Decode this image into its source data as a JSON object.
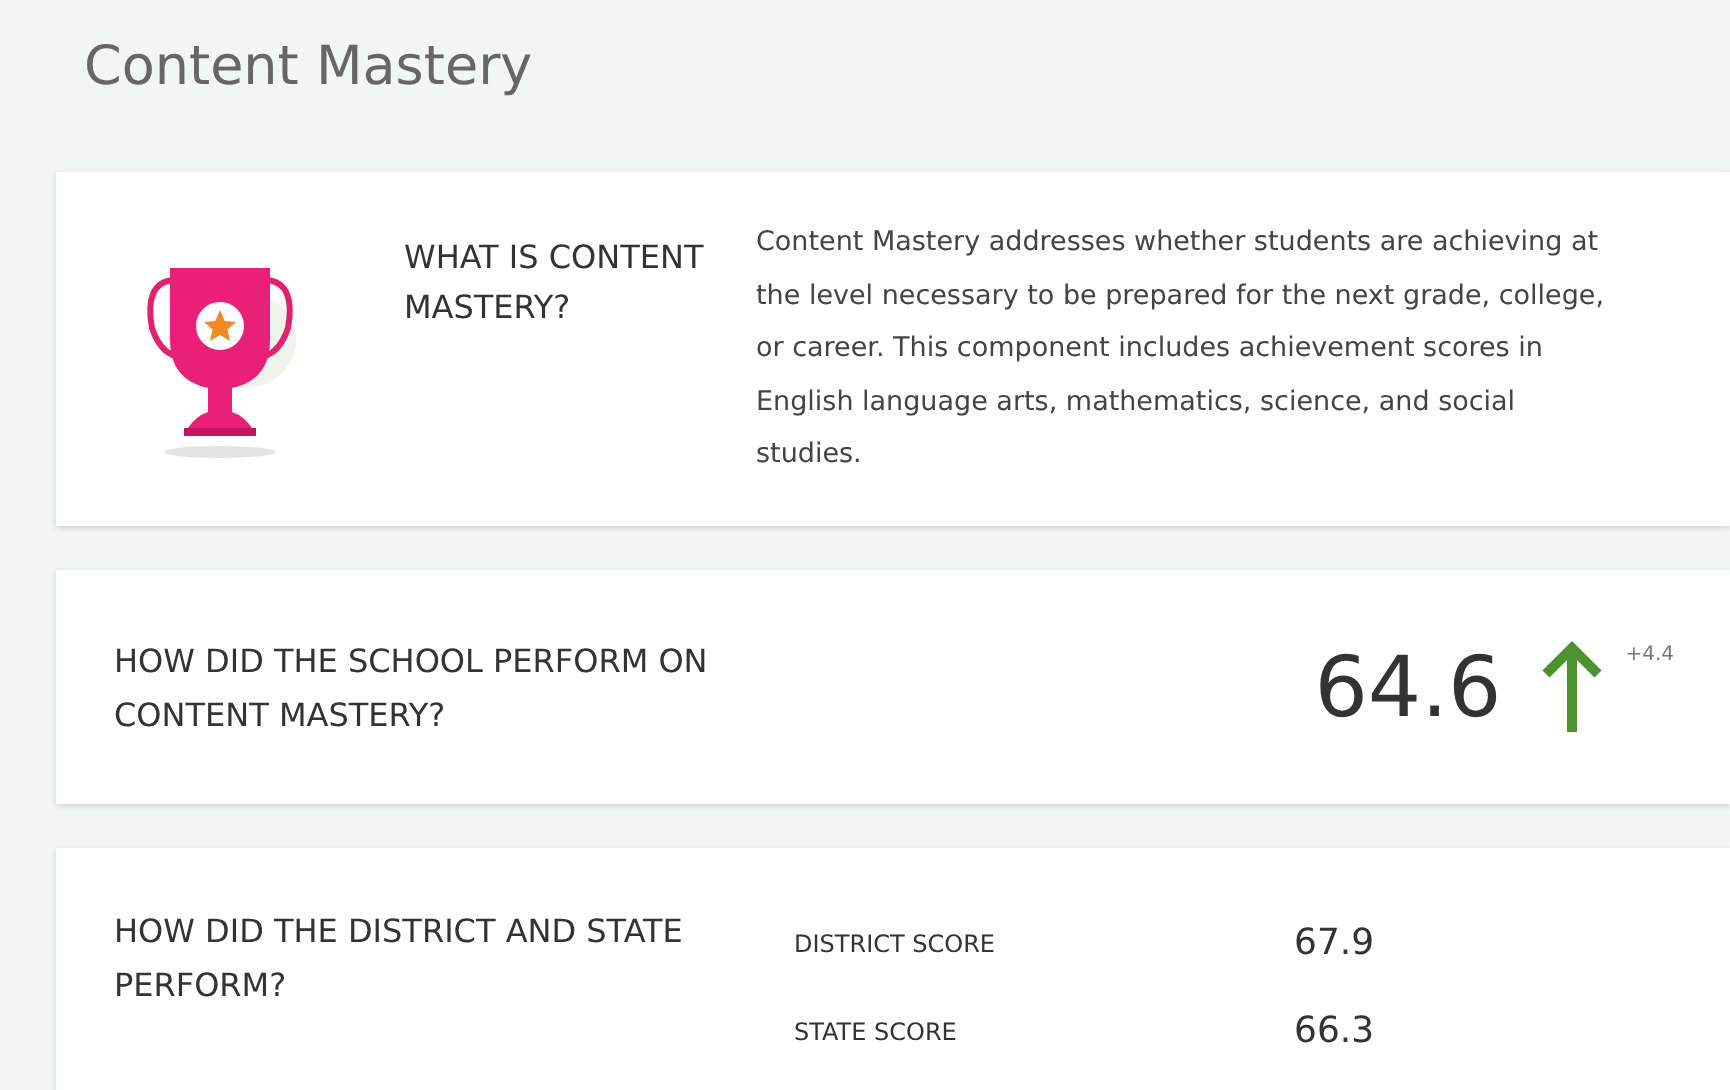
{
  "page_title": "Content Mastery",
  "about": {
    "heading": "WHAT IS CONTENT MASTERY?",
    "text": "Content Mastery addresses whether students are achieving at the level necessary to be prepared for the next grade, college, or career. This component includes achievement scores in English language arts, mathematics, science, and social studies."
  },
  "school": {
    "heading": "HOW DID THE SCHOOL PERFORM ON CONTENT MASTERY?",
    "score": "64.6",
    "rising": true,
    "change": "+4.4"
  },
  "comparison": {
    "heading": "HOW DID THE DISTRICT AND STATE PERFORM?",
    "rows": [
      {
        "label": "DISTRICT SCORE",
        "value": "67.9"
      },
      {
        "label": "STATE SCORE",
        "value": "66.3"
      }
    ]
  }
}
